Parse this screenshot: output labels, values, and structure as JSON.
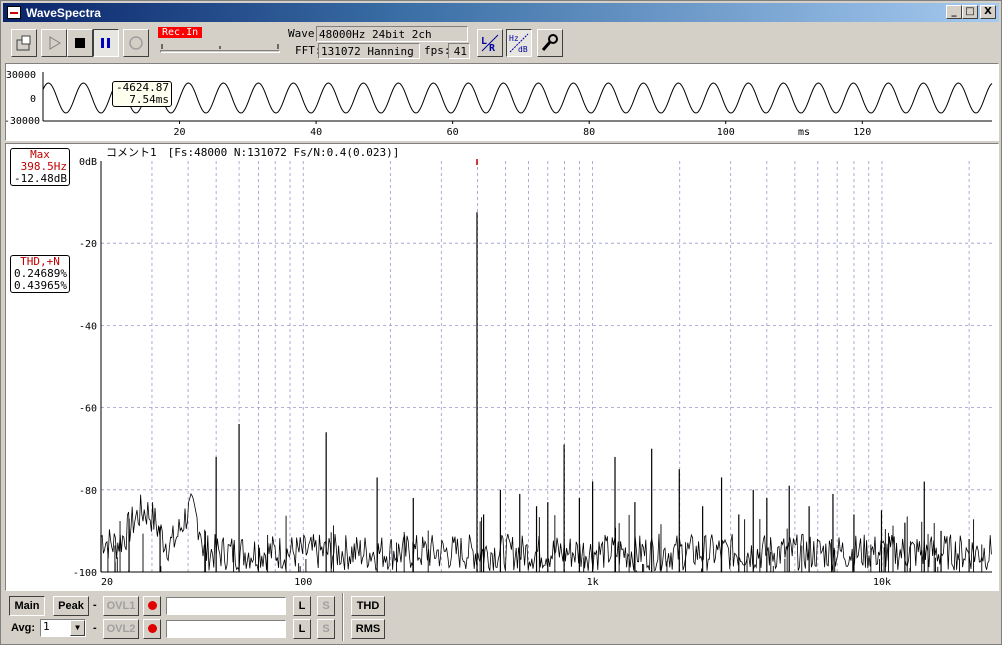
{
  "window": {
    "title": "WaveSpectra",
    "minimize": "_",
    "maximize": "□",
    "close": "X"
  },
  "toolbar": {
    "rec_label": "Rec.In",
    "wave_label": "Wave:",
    "wave_value": "48000Hz 24bit 2ch",
    "fft_label": "FFT:",
    "fft_value": "131072 Hanning",
    "fps_label": "fps:",
    "fps_value": "41",
    "icons": [
      "open-file-icon",
      "play-icon",
      "stop-icon",
      "pause-icon",
      "record-icon",
      "lr-channel-icon",
      "hz-db-icon",
      "settings-wrench-icon"
    ]
  },
  "waveform": {
    "yticks": [
      "30000",
      "0",
      "-30000"
    ],
    "xticks": [
      "20",
      "40",
      "60",
      "80",
      "100",
      "120"
    ],
    "x_unit": "ms",
    "cursor_value": "-4624.87",
    "cursor_time": "7.54ms"
  },
  "spectrum": {
    "header": "コメント1　[Fs:48000 N:131072 Fs/N:0.4(0.023)]",
    "yticks": [
      "0dB",
      "-20",
      "-40",
      "-60",
      "-80",
      "-100"
    ],
    "xticks": [
      "20",
      "100",
      "1k",
      "10k"
    ],
    "max_label": "Max",
    "max_freq": "398.5Hz",
    "max_level": "-12.48dB",
    "thd_label": "THD,+N",
    "thd_value": "0.24689%",
    "thdn_value": "0.43965%"
  },
  "controls": {
    "main": "Main",
    "peak": "Peak",
    "dash1": "-",
    "dash2": "-",
    "ovl1": "OVL1",
    "ovl2": "OVL2",
    "avg_label": "Avg:",
    "avg_value": "1",
    "l1": "L",
    "s1": "S",
    "l2": "L",
    "s2": "S",
    "thd": "THD",
    "rms": "RMS"
  },
  "chart_data": {
    "type": "line",
    "title": "",
    "xlabel": "",
    "ylabel": "",
    "x_scale": "log",
    "xlim": [
      20,
      24000
    ],
    "ylim": [
      -100,
      0
    ],
    "grid": true,
    "fundamental": {
      "x": 398.5,
      "y": -12.48
    },
    "peaks": [
      {
        "x": 20,
        "y": -91
      },
      {
        "x": 25,
        "y": -87
      },
      {
        "x": 32,
        "y": -89
      },
      {
        "x": 50,
        "y": -72
      },
      {
        "x": 60,
        "y": -64
      },
      {
        "x": 120,
        "y": -66
      },
      {
        "x": 180,
        "y": -77
      },
      {
        "x": 240,
        "y": -82
      },
      {
        "x": 398.5,
        "y": -12.48
      },
      {
        "x": 420,
        "y": -86
      },
      {
        "x": 480,
        "y": -80
      },
      {
        "x": 560,
        "y": -81
      },
      {
        "x": 640,
        "y": -84
      },
      {
        "x": 700,
        "y": -83
      },
      {
        "x": 797,
        "y": -69
      },
      {
        "x": 900,
        "y": -82
      },
      {
        "x": 1000,
        "y": -78
      },
      {
        "x": 1195,
        "y": -72
      },
      {
        "x": 1400,
        "y": -83
      },
      {
        "x": 1600,
        "y": -70
      },
      {
        "x": 1993,
        "y": -75
      },
      {
        "x": 2400,
        "y": -84
      },
      {
        "x": 2790,
        "y": -77
      },
      {
        "x": 3200,
        "y": -86
      },
      {
        "x": 3590,
        "y": -80
      },
      {
        "x": 4000,
        "y": -82
      },
      {
        "x": 4780,
        "y": -79
      },
      {
        "x": 5600,
        "y": -84
      },
      {
        "x": 6770,
        "y": -81
      },
      {
        "x": 8000,
        "y": -86
      },
      {
        "x": 9960,
        "y": -85
      },
      {
        "x": 12000,
        "y": -88
      },
      {
        "x": 14000,
        "y": -78
      },
      {
        "x": 16000,
        "y": -90
      },
      {
        "x": 20000,
        "y": -92
      }
    ],
    "noise_floor": -97
  }
}
